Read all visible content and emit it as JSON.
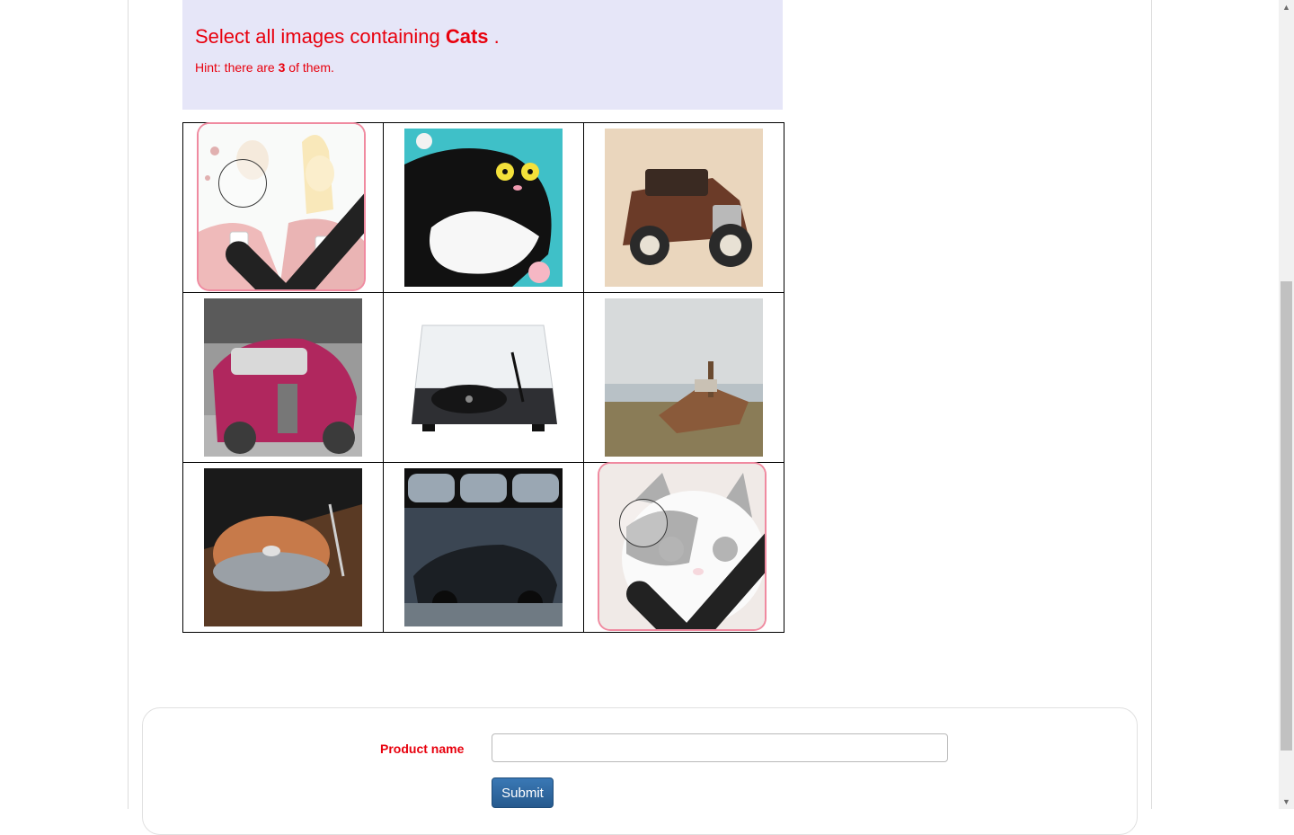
{
  "captcha": {
    "prompt_prefix": "Select all images containing",
    "target": "Cats",
    "prompt_suffix": ".",
    "hint_prefix": "Hint: there are",
    "hint_count": "3",
    "hint_suffix": "of them."
  },
  "grid": {
    "tiles": [
      {
        "subject": "couple-drinking-painting",
        "selected": true
      },
      {
        "subject": "cartoon-cat",
        "selected": false
      },
      {
        "subject": "vintage-car",
        "selected": false
      },
      {
        "subject": "pink-rusty-car",
        "selected": false
      },
      {
        "subject": "turntable",
        "selected": false
      },
      {
        "subject": "shipwreck",
        "selected": false
      },
      {
        "subject": "copper-turntable",
        "selected": false
      },
      {
        "subject": "car-mirrors-rain",
        "selected": false
      },
      {
        "subject": "cat-photo",
        "selected": true
      }
    ]
  },
  "form": {
    "product_label": "Product name",
    "product_value": "",
    "submit_label": "Submit"
  },
  "colors": {
    "accent": "#e8000d",
    "header_bg": "#e6e6f8",
    "button": "#2d6aa3",
    "selected_border": "#f08aa0"
  },
  "icons": {
    "check": "checkmark-icon",
    "scroll_up": "scroll-up-icon",
    "scroll_down": "scroll-down-icon"
  }
}
